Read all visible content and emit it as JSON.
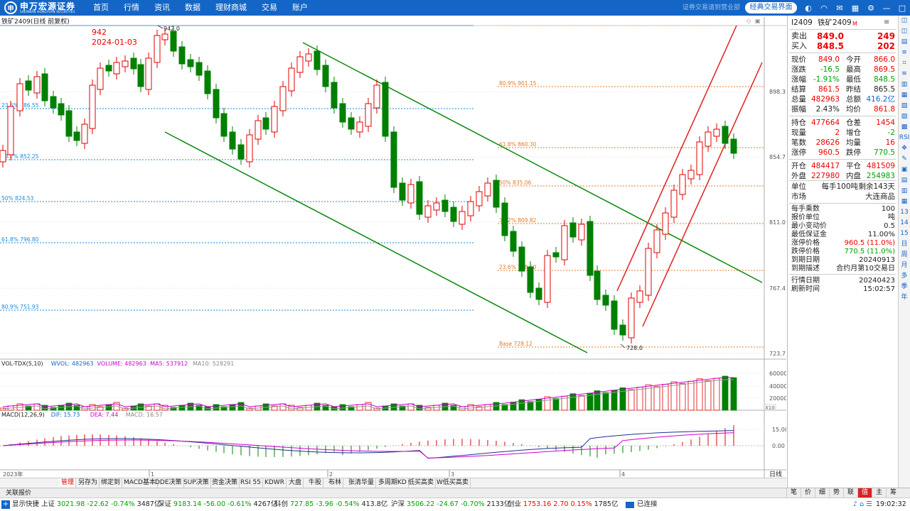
{
  "header": {
    "logo_mark": "申",
    "logo_cn": "申万宏源证券",
    "logo_en": "SHENWAN HONGYUAN SECURITIES",
    "nav": [
      "首页",
      "行情",
      "资讯",
      "数据",
      "理财商城",
      "交易",
      "账户"
    ],
    "slogan": "证券交易请到营业部",
    "classic_button": "经典交易界面"
  },
  "chart": {
    "title": "铁矿2409(日线 前复权)",
    "high_label": "942",
    "high_date": "2024-01-03",
    "high_marker": "942.0",
    "low_marker": "728.0",
    "price_axis": [
      "898.3",
      "854.7",
      "811.0",
      "767.4",
      "723.7"
    ],
    "fib_left": [
      "23.6% 886.55",
      "38.2% 852.25",
      "50% 824.53",
      "61.8% 796.80",
      "80.9% 751.93"
    ],
    "fib_right": [
      "80.9% 901.15",
      "61.8% 860.30",
      "50% 835.06",
      "38.2% 809.82",
      "23.6% 778.60",
      "Base 728.12"
    ],
    "vol_legend": [
      {
        "text": "VOL-TDX(5,10)",
        "color": "#222"
      },
      {
        "text": "WVOL: 482963",
        "color": "#1466c6"
      },
      {
        "text": "VOLUME: 482963",
        "color": "#d000d0"
      },
      {
        "text": "MA5: 537912",
        "color": "#d000d0"
      },
      {
        "text": "MA10: 528291",
        "color": "#888"
      }
    ],
    "vol_axis": [
      "60000",
      "40000",
      "20000"
    ],
    "vol_unit": "X10",
    "macd_legend": [
      {
        "text": "MACD(12,26,9)",
        "color": "#222"
      },
      {
        "text": "DIF: 15.73",
        "color": "#1466c6"
      },
      {
        "text": "DEA: 7.44",
        "color": "#d000d0"
      },
      {
        "text": "MACD: 16.57",
        "color": "#888"
      }
    ],
    "macd_axis": [
      "15.00",
      "0.00"
    ],
    "date_axis": [
      "2023年",
      "1",
      "2",
      "3",
      "4"
    ],
    "period_label": "日线"
  },
  "tabs": [
    "管理",
    "另存为",
    "绑定到",
    "MACD基本",
    "DDE决策",
    "SUP决策",
    "资金决策",
    "RSI 55",
    "KDWR",
    "大盘",
    "牛股",
    "布林",
    "张清华量",
    "多周期KD",
    "低买高卖",
    "W低买高卖"
  ],
  "right_panel": {
    "code": "I2409",
    "name": "铁矿2409",
    "m": "M",
    "sell_label": "卖出",
    "sell_price": "849.0",
    "sell_vol": "249",
    "buy_label": "买入",
    "buy_price": "848.5",
    "buy_vol": "202",
    "rows": [
      {
        "l1": "现价",
        "v1": "849.0",
        "c1": "red",
        "l2": "今开",
        "v2": "866.0",
        "c2": "red"
      },
      {
        "l1": "涨跌",
        "v1": "-16.5",
        "c1": "green",
        "l2": "最高",
        "v2": "869.5",
        "c2": "red"
      },
      {
        "l1": "涨幅",
        "v1": "-1.91%",
        "c1": "green",
        "l2": "最低",
        "v2": "848.5",
        "c2": "green"
      },
      {
        "l1": "结算",
        "v1": "861.5",
        "c1": "red",
        "l2": "昨结",
        "v2": "865.5",
        "c2": "dark"
      },
      {
        "l1": "总量",
        "v1": "482963",
        "c1": "red",
        "l2": "总额",
        "v2": "416.2亿",
        "c2": "blue"
      },
      {
        "l1": "振幅",
        "v1": "2.43%",
        "c1": "dark",
        "l2": "均价",
        "v2": "861.8",
        "c2": "red"
      },
      {
        "l1": "持仓",
        "v1": "477664",
        "c1": "red",
        "l2": "仓差",
        "v2": "1454",
        "c2": "red"
      },
      {
        "l1": "现量",
        "v1": "2",
        "c1": "red",
        "l2": "增仓",
        "v2": "-2",
        "c2": "green"
      },
      {
        "l1": "笔数",
        "v1": "28626",
        "c1": "red",
        "l2": "均量",
        "v2": "16",
        "c2": "red"
      },
      {
        "l1": "涨停",
        "v1": "960.5",
        "c1": "red",
        "l2": "跌停",
        "v2": "770.5",
        "c2": "green"
      },
      {
        "l1": "开仓",
        "v1": "484417",
        "c1": "red",
        "l2": "平仓",
        "v2": "481509",
        "c2": "red"
      },
      {
        "l1": "外盘",
        "v1": "227980",
        "c1": "red",
        "l2": "内盘",
        "v2": "254983",
        "c2": "green"
      }
    ],
    "unit_label": "单位",
    "unit_value": "每手100吨",
    "remain": "剩余143天",
    "market_label": "市场",
    "market_value": "大连商品",
    "info": [
      {
        "l": "每手乘数",
        "v": "100",
        "c": "dark"
      },
      {
        "l": "报价单位",
        "v": "吨",
        "c": "dark"
      },
      {
        "l": "最小变动价",
        "v": "0.5",
        "c": "dark"
      },
      {
        "l": "最低保证金",
        "v": "11.00%",
        "c": "dark"
      },
      {
        "l": "涨停价格",
        "v": "960.5 (11.0%)",
        "c": "red"
      },
      {
        "l": "跌停价格",
        "v": "770.5 (11.0%)",
        "c": "green"
      },
      {
        "l": "到期日期",
        "v": "20240913",
        "c": "dark"
      },
      {
        "l": "到期描述",
        "v": "合约月第10交易日",
        "c": "dark"
      },
      {
        "l": "行情日期",
        "v": "20240423",
        "c": "dark"
      },
      {
        "l": "刷新时间",
        "v": "15:02:57",
        "c": "dark"
      }
    ],
    "tabs": [
      "笔",
      "价",
      "细",
      "势",
      "联",
      "值",
      "主",
      "筹"
    ]
  },
  "right_sidebar": [
    "13",
    "14",
    "15",
    "日",
    "周",
    "月",
    "多",
    "季",
    "年"
  ],
  "bottom": {
    "quote_label": "关联报价",
    "toggle_label": "显示快捷",
    "indices": [
      {
        "name": "上证",
        "value": "3021.98",
        "chg": "-22.62",
        "pct": "-0.74%",
        "amt": "3487亿",
        "c": "green"
      },
      {
        "name": "深证",
        "value": "9183.14",
        "chg": "-56.00",
        "pct": "-0.61%",
        "amt": "4267亿",
        "c": "green"
      },
      {
        "name": "科创",
        "value": "727.85",
        "chg": "-3.96",
        "pct": "-0.54%",
        "amt": "413.8亿",
        "c": "green"
      },
      {
        "name": "沪深",
        "value": "3506.22",
        "chg": "-24.67",
        "pct": "-0.70%",
        "amt": "2133亿",
        "c": "green"
      },
      {
        "name": "创业",
        "value": "1753.16",
        "chg": "2.70",
        "pct": "0.15%",
        "amt": "1785亿",
        "c": "red"
      }
    ],
    "connected": "已连接",
    "clock": "19:02:32"
  },
  "colors": {
    "up": "#e00000",
    "down": "#008000",
    "accent": "#1466c6",
    "fib_left": "#1a8ad8",
    "fib_right": "#e07a2a"
  }
}
